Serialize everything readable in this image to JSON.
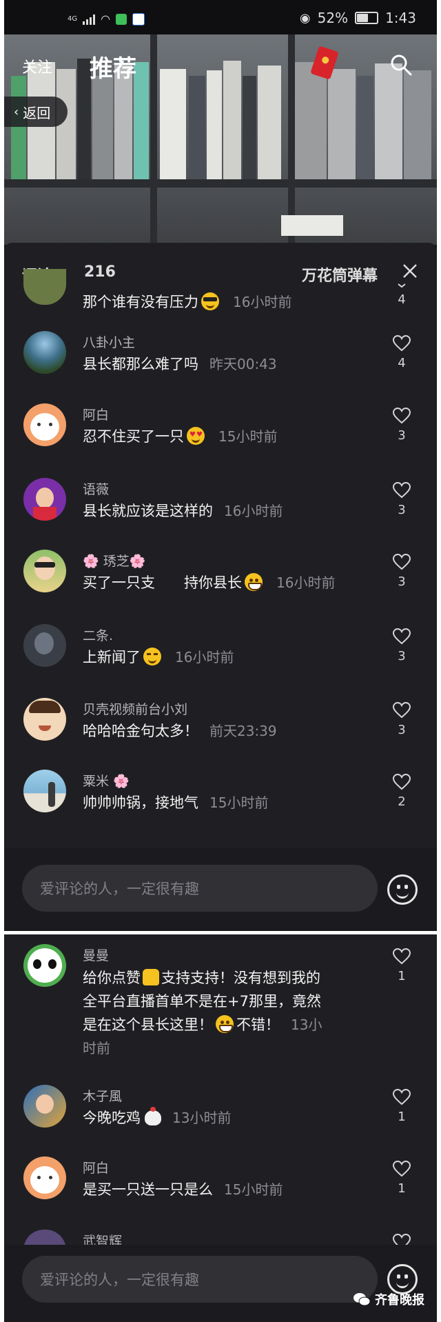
{
  "status_bar": {
    "network": "4G",
    "battery": "52%",
    "battery_fraction": 0.52,
    "time": "1:43"
  },
  "top_nav": {
    "follow": "关注",
    "recommend": "推荐",
    "back": "返回"
  },
  "panel": {
    "title": "评论",
    "count": "216",
    "danmaku": "万花筒弹幕"
  },
  "comments": [
    {
      "user": "",
      "text": "那个谁有没有压力",
      "emoji": "cool",
      "time": "16小时前",
      "likes": "4"
    },
    {
      "user": "八卦小主",
      "text": "县长都那么难了吗",
      "emoji": "",
      "time": "昨天00:43",
      "likes": "4"
    },
    {
      "user": "阿白",
      "text": "忍不住买了一只",
      "emoji": "heart-eyes",
      "time": "15小时前",
      "likes": "3"
    },
    {
      "user": "语薇",
      "text": "县长就应该是这样的",
      "emoji": "",
      "time": "16小时前",
      "likes": "3"
    },
    {
      "user": "🌸 琇芝🌸",
      "text": "买了一只支　　持你县长",
      "emoji": "grin",
      "time": "16小时前",
      "likes": "3"
    },
    {
      "user": "二条.",
      "text": "上新闻了",
      "emoji": "smirk",
      "time": "16小时前",
      "likes": "3"
    },
    {
      "user": "贝壳视频前台小刘",
      "text": "哈哈哈金句太多！",
      "emoji": "",
      "time": "前天23:39",
      "likes": "3"
    },
    {
      "user": "粟米 🌸",
      "text": "帅帅帅锅，接地气",
      "emoji": "",
      "time": "15小时前",
      "likes": "2"
    }
  ],
  "comments2": [
    {
      "user": "曼曼",
      "line1_a": "给你点赞",
      "line1_b": "支持支持！没有想到我的",
      "line2": "全平台直播首单不是在+7那里，竟然",
      "line3_a": "是在这个县长这里！",
      "line3_b": "不错！",
      "time_a": "13小",
      "time_b": "时前",
      "likes": "1"
    },
    {
      "user": "木子風",
      "text": "今晚吃鸡",
      "emoji": "chicken",
      "time": "13小时前",
      "likes": "1"
    },
    {
      "user": "阿白",
      "text": "是买一只送一只是么",
      "emoji": "",
      "time": "15小时前",
      "likes": "1"
    },
    {
      "user": "武智辉",
      "text": "",
      "emoji": "",
      "time": "",
      "likes": ""
    }
  ],
  "input_placeholder": "爱评论的人，一定很有趣",
  "watermark": "齐鲁晚报",
  "colors": {
    "panel": "#1f1f23",
    "status_bg": "#0f0f11",
    "red_packet": "#d8232a",
    "emoji_yellow": "#f5c21f"
  }
}
